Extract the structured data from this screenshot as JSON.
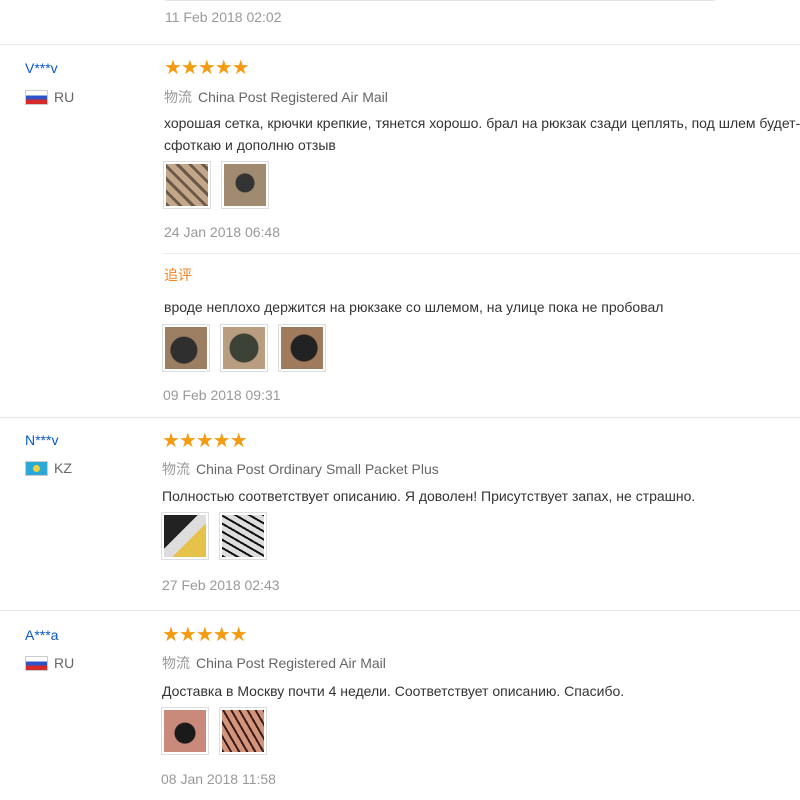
{
  "top_date": "11 Feb 2018 02:02",
  "logistics_key": "物流",
  "reviews": [
    {
      "user": "V***v",
      "country": "RU",
      "stars": "★★★★★",
      "logistics": "China Post Registered Air Mail",
      "content": "хорошая сетка, крючки крепкие, тянется хорошо. брал на рюкзак сзади цеплять, под шлем будет-сфоткаю и дополню отзыв",
      "date": "24 Jan 2018 06:48",
      "followup": {
        "label": "追评",
        "content": "вроде неплохо держится на рюкзаке со шлемом, на улице пока не пробовал",
        "date": "09 Feb 2018 09:31"
      }
    },
    {
      "user": "N***v",
      "country": "KZ",
      "stars": "★★★★★",
      "logistics": "China Post Ordinary Small Packet Plus",
      "content": "Полностью соответствует описанию. Я доволен! Присутствует запах, не страшно.",
      "date": "27 Feb 2018 02:43"
    },
    {
      "user": "A***a",
      "country": "RU",
      "stars": "★★★★★",
      "logistics": "China Post Registered Air Mail",
      "content": "Доставка в Москву почти 4 недели. Соответствует описанию. Спасибо.",
      "date": "08 Jan 2018 11:58"
    }
  ]
}
